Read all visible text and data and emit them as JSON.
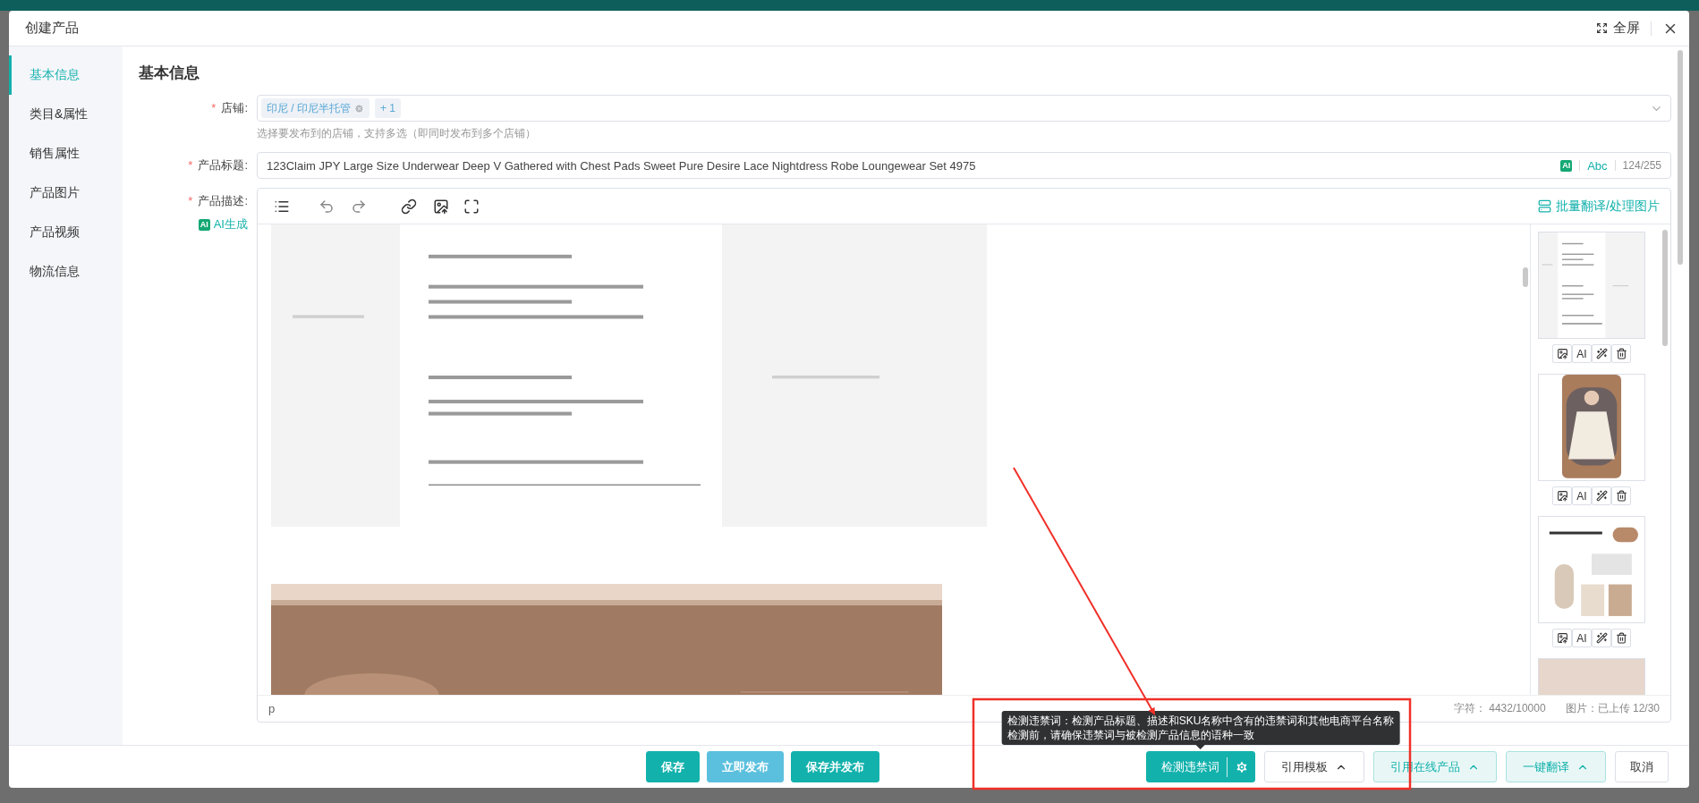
{
  "dialog": {
    "title": "创建产品",
    "fullscreen_label": "全屏"
  },
  "nav": [
    {
      "label": "基本信息",
      "selected": true
    },
    {
      "label": "类目&属性",
      "selected": false
    },
    {
      "label": "销售属性",
      "selected": false
    },
    {
      "label": "产品图片",
      "selected": false
    },
    {
      "label": "产品视频",
      "selected": false
    },
    {
      "label": "物流信息",
      "selected": false
    }
  ],
  "section_title": "基本信息",
  "store": {
    "label": "店铺:",
    "required_mark": "*",
    "tags": [
      "印尼 / 印尼半托管"
    ],
    "more": "+ 1",
    "hint": "选择要发布到的店铺，支持多选（即同时发布到多个店铺）"
  },
  "product_title": {
    "label": "产品标题:",
    "required_mark": "*",
    "value": "123Claim JPY Large Size Underwear Deep V Gathered with Chest Pads Sweet Pure Desire Lace Nightdress Robe Loungewear Set 4975",
    "ai_badge": "AI",
    "abc": "Abc",
    "counter": "124/255"
  },
  "description": {
    "label": "产品描述:",
    "required_mark": "*",
    "ai_badge": "AI",
    "ai_generate": "AI生成",
    "batch_action": "批量翻译/处理图片",
    "content": [
      {
        "kind": "document"
      },
      {
        "kind": "banner"
      }
    ],
    "thumbnails": [
      {
        "kind": "document",
        "ai_label": "AI"
      },
      {
        "ai_label": "AI"
      },
      {
        "kind": "collage",
        "ai_label": "AI"
      },
      {
        "kind": "closeup"
      }
    ],
    "path": "p",
    "chars": "字符：  4432/10000",
    "images": "图片：已上传 12/30"
  },
  "tooltip": [
    "检测违禁词：检测产品标题、描述和SKU名称中含有的违禁词和其他电商平台名称",
    "检测前，请确保违禁词与被检测产品信息的语种一致"
  ],
  "footer": {
    "left": [
      {
        "label": "保存",
        "kind": "solid"
      },
      {
        "label": "立即发布",
        "kind": "light"
      },
      {
        "label": "保存并发布",
        "kind": "solid"
      }
    ],
    "right": [
      {
        "label": "检测违禁词",
        "kind": "split"
      },
      {
        "label": "引用模板",
        "kind": "outline-menu"
      },
      {
        "label": "引用在线产品",
        "kind": "tint-menu"
      },
      {
        "label": "一键翻译",
        "kind": "tint-menu"
      },
      {
        "label": "取消",
        "kind": "outline"
      }
    ]
  }
}
